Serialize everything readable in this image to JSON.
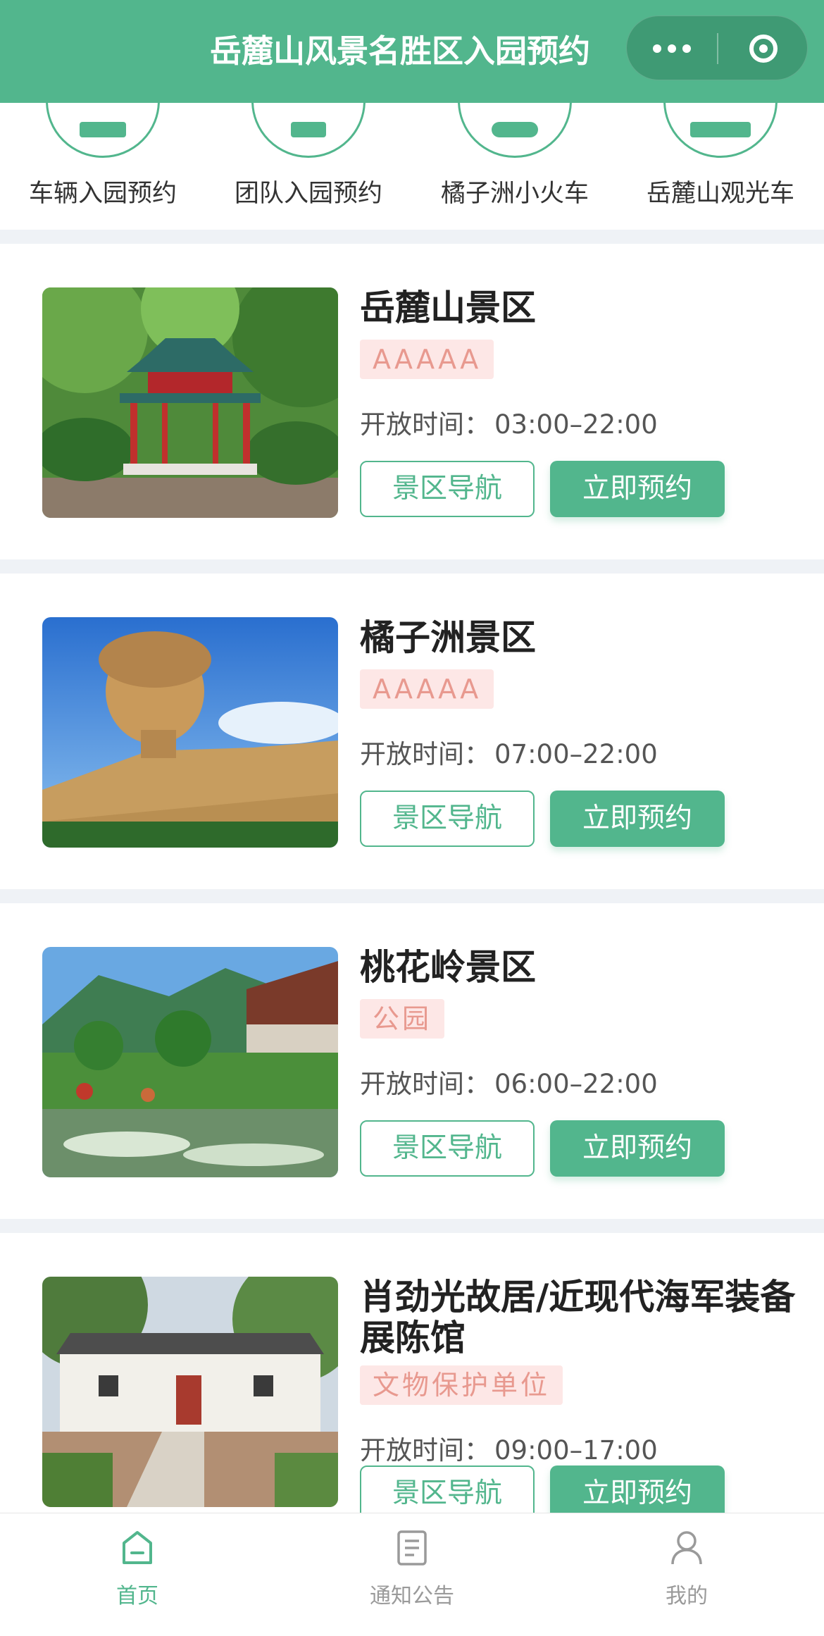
{
  "header": {
    "title": "岳麓山风景名胜区入园预约"
  },
  "categories": [
    {
      "label": "车辆入园预约",
      "icon": "car-icon"
    },
    {
      "label": "团队入园预约",
      "icon": "group-icon"
    },
    {
      "label": "橘子洲小火车",
      "icon": "train-icon"
    },
    {
      "label": "岳麓山观光车",
      "icon": "bus-icon"
    }
  ],
  "hours_label": "开放时间：",
  "buttons": {
    "nav": "景区导航",
    "book": "立即预约"
  },
  "spots": [
    {
      "name": "岳麓山景区",
      "badge": "AAAAA",
      "hours": "03:00–22:00"
    },
    {
      "name": "橘子洲景区",
      "badge": "AAAAA",
      "hours": "07:00–22:00"
    },
    {
      "name": "桃花岭景区",
      "badge": "公园",
      "hours": "06:00–22:00"
    },
    {
      "name": "肖劲光故居/近现代海军装备展陈馆",
      "badge": "文物保护单位",
      "hours": "09:00–17:00"
    }
  ],
  "tabs": [
    {
      "label": "首页",
      "active": true
    },
    {
      "label": "通知公告",
      "active": false
    },
    {
      "label": "我的",
      "active": false
    }
  ],
  "colors": {
    "primary": "#52b68d",
    "badge_bg": "#fde7e6",
    "badge_text": "#e8998f"
  }
}
